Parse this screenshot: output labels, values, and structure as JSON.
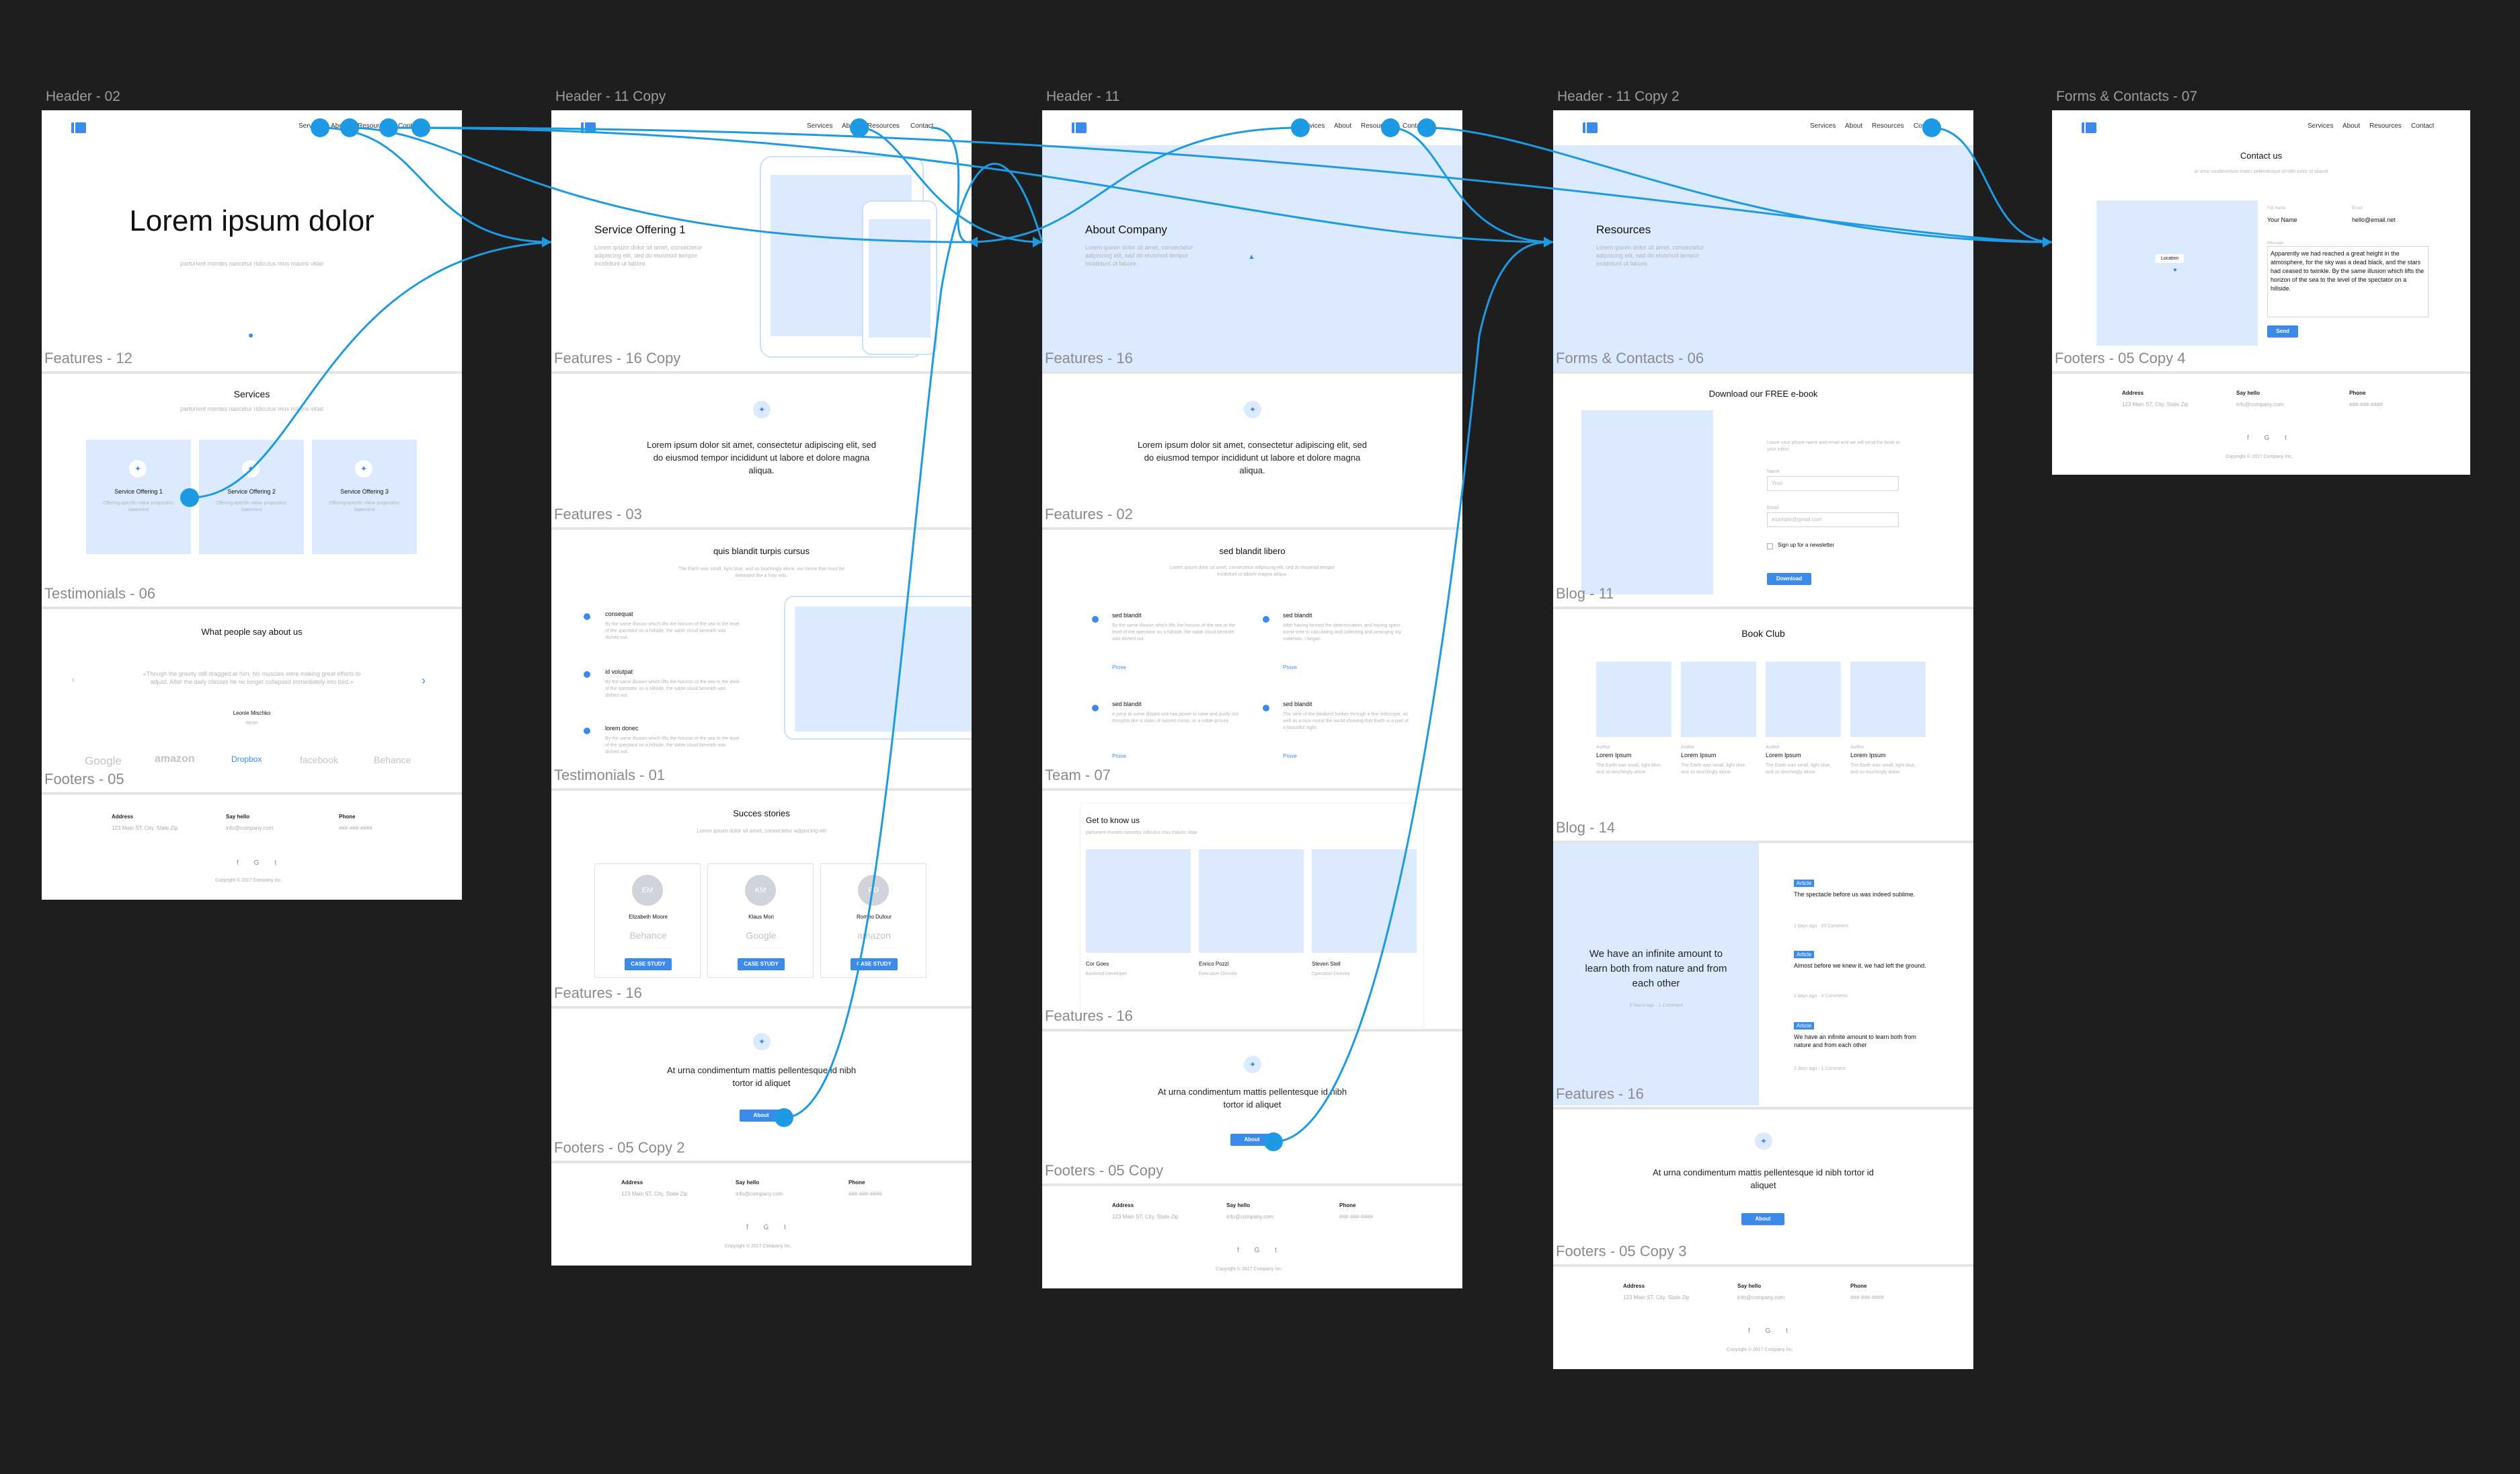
{
  "artboards": {
    "a1": {
      "title": "Header - 02",
      "hero": "Lorem ipsum dolor",
      "hero_sub": "parturient montes nascetur ridiculus mus mauris vitae",
      "nav": [
        "Services",
        "About",
        "Resources",
        "Contact"
      ],
      "sections": [
        "Features - 12",
        "Testimonials - 06",
        "Footers - 05"
      ],
      "services_title": "Services",
      "services_sub": "parturient montes nascetur ridiculus mus mauris vitae",
      "offerings": [
        "Service Offering 1",
        "Service Offering 2",
        "Service Offering 3"
      ],
      "offering_desc": "Offering-specific value proposition statement",
      "testimonial_title": "What people say about us",
      "quote": "«Though the gravity still dragged at him, his muscles were making great efforts to adjust. After the daily classes he no longer collapsed immediately into bed.»",
      "quote_author": "Leonie Mischko",
      "quote_role": "Writer",
      "logos": [
        "Google",
        "amazon",
        "Dropbox",
        "facebook",
        "Behance"
      ]
    },
    "a2": {
      "title": "Header - 11 Copy",
      "hero": "Service Offering 1",
      "hero_sub": "Lorem ipsum dolor sit amet, consectetur adipiscing elit, sed do eiusmod tempor incididunt ut labore.",
      "sections": [
        "Features - 16 Copy",
        "Features - 03",
        "Testimonials - 01",
        "Features - 16",
        "Footers - 05 Copy 2"
      ],
      "f03_text": "Lorem ipsum dolor sit amet, consectetur adipiscing elit, sed do eiusmod tempor incididunt ut labore et dolore magna aliqua.",
      "cursus_title": "quis blandit turpis cursus",
      "cursus_sub": "The Earth was small, light blue, and so touchingly alone, our home that must be defended like a holy relic.",
      "bullets": [
        "consequat",
        "id volutpat",
        "lorem donec"
      ],
      "bullet_desc": "By the same illusion which lifts the horizon of the sea to the level of the spectator on a hillside, the sable cloud beneath was dished out.",
      "success_title": "Succes stories",
      "success_sub": "Lorem ipsum dolor sit amet, consectetur adipiscing elit",
      "people": [
        {
          "initials": "EM",
          "name": "Elizabeth Moore",
          "logo": "Behance"
        },
        {
          "initials": "KM",
          "name": "Klaus Mori",
          "logo": "Google"
        },
        {
          "initials": "RD",
          "name": "Romeo Dufour",
          "logo": "amazon"
        }
      ],
      "case_btn": "CASE STUDY",
      "cta": "At urna condimentum mattis pellentesque id nibh tortor id aliquet",
      "cta_btn": "About"
    },
    "a3": {
      "title": "Header - 11",
      "hero": "About Company",
      "hero_sub": "Lorem ipsum dolor sit amet, consectetur adipiscing elit, sed do eiusmod tempor incididunt ut labore.",
      "sections": [
        "Features - 16",
        "Features - 02",
        "Team - 07",
        "Features - 16",
        "Footers - 05 Copy"
      ],
      "f02_text": "Lorem ipsum dolor sit amet, consectetur adipiscing elit, sed do eiusmod tempor incididunt ut labore et dolore magna aliqua.",
      "libero_title": "sed blandit libero",
      "libero_sub": "Lorem ipsum dolor sit amet, consectetur adipiscing elit, sed do eiusmod tempor incididunt ut labore magna aliqua.",
      "items": [
        {
          "t": "sed blandit",
          "d": "By the same illusion which lifts the horizon of the sea to the level of the spectator on a hillside, the sable cloud beneath was dished out."
        },
        {
          "t": "sed blandit",
          "d": "After having formed the determination, and having spent some time in calculating and collecting and arranging my materials, I began."
        },
        {
          "t": "sed blandit",
          "d": "A jump at some distant unit has power to raise and purify our thoughts like a strain of sacred music, or a noble picture."
        },
        {
          "t": "sed blandit",
          "d": "The view of the bleakest bodies through a fine telescope, as well as a nice round the world showing that Earth is a part of a beautiful night."
        }
      ],
      "prev": "Prove",
      "team_title": "Get to know us",
      "team_sub": "parturient montes nascetur ridiculus mus mauris vitae",
      "team": [
        {
          "n": "Cor Goes",
          "r": "Backend Developer"
        },
        {
          "n": "Enrico Pozzi",
          "r": "Executive Director"
        },
        {
          "n": "Steven Stell",
          "r": "Operation Director"
        }
      ],
      "cta": "At urna condimentum mattis pellentesque id nibh tortor id aliquet",
      "cta_btn": "About"
    },
    "a4": {
      "title": "Header - 11 Copy 2",
      "hero": "Resources",
      "hero_sub": "Lorem ipsum dolor sit amet, consectetur adipiscing elit, sed do eiusmod tempor incididunt ut labore.",
      "sections": [
        "Forms & Contacts - 06",
        "Blog - 11",
        "Blog - 14",
        "Features - 16",
        "Footers - 05 Copy 3"
      ],
      "ebook_title": "Download our FREE e-book",
      "ebook_sub": "Leave your phone name and email and we will send the book to your inbox.",
      "name_label": "Name",
      "name_ph": "Your",
      "email_label": "Email",
      "email_ph": "example@gmail.com",
      "newsletter": "Sign up for a newsletter",
      "download_btn": "Download",
      "club_title": "Book Club",
      "book_author": "Author",
      "book_name": "Lorem Ipsum",
      "book_desc": "The Earth was small, light blue, and so touchingly alone.",
      "blog_quote": "We have an infinite amount to learn both from nature and from each other",
      "blog_meta": "6 hours ago  ·  1 Comment",
      "posts": [
        {
          "tag": "Article",
          "t": "The spectacle before us was indeed sublime.",
          "m": "2 days ago   ·  20 Comment"
        },
        {
          "tag": "Article",
          "t": "Almost before we knew it, we had left the ground.",
          "m": "2 days ago   ·  4 Comments"
        },
        {
          "tag": "Article",
          "t": "We have an infinite amount to learn both from nature and from each other",
          "m": "2 days ago   ·  1 Comment"
        }
      ],
      "cta": "At urna condimentum mattis pellentesque id nibh tortor id aliquet",
      "cta_btn": "About"
    },
    "a5": {
      "title": "Forms & Contacts - 07",
      "contact_title": "Contact us",
      "contact_sub": "at urna condimentum mattis pellentesque id nibh tortor id aliquet",
      "sections": [
        "Footers - 05 Copy 4"
      ],
      "location": "Location",
      "name_label": "Full Name",
      "name_val": "Your Name",
      "email_label": "Email",
      "email_val": "hello@email.net",
      "msg_label": "Message",
      "message": "Apparently we had reached a great height in the atmosphere, for the sky was a dead black, and the stars had ceased to twinkle. By the same illusion which lifts the horizon of the sea to the level of the spectator on a hillside.",
      "send": "Send"
    }
  },
  "footer": {
    "address_label": "Address",
    "address": "123 Main ST, City, State Zip",
    "hello_label": "Say hello",
    "hello": "info@company.com",
    "phone_label": "Phone",
    "phone": "###-###-####",
    "social": "f G t",
    "copyright": "Copyright © 2017 Company Inc."
  },
  "colors": {
    "accent": "#3d8be8",
    "placeholder": "#dbeafe",
    "canvas": "#1e1e1f",
    "link": "#1d9ae3"
  }
}
